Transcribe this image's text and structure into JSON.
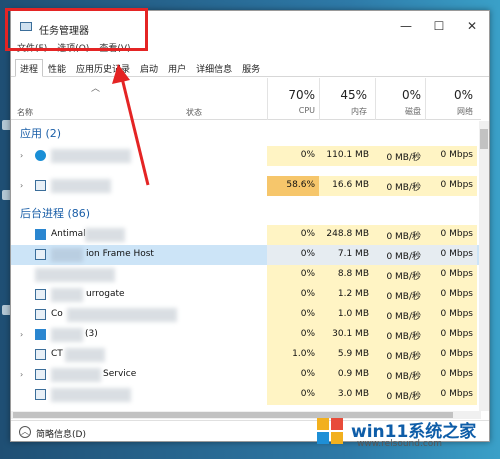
{
  "window": {
    "title": "任务管理器",
    "controls": [
      "—",
      "☐",
      "✕"
    ]
  },
  "menu": [
    "文件(F)",
    "选项(O)",
    "查看(V)"
  ],
  "tabs": [
    "进程",
    "性能",
    "应用历史记录",
    "启动",
    "用户",
    "详细信息",
    "服务"
  ],
  "header": {
    "name": "名称",
    "status": "状态",
    "cpu": {
      "pct": "70%",
      "label": "CPU"
    },
    "mem": {
      "pct": "45%",
      "label": "内存"
    },
    "disk": {
      "pct": "0%",
      "label": "磁盘"
    },
    "net": {
      "pct": "0%",
      "label": "网络"
    }
  },
  "groups": {
    "apps": "应用 (2)",
    "bg": "后台进程 (86)"
  },
  "rows": [
    {
      "name": "",
      "cpu": "0%",
      "mem": "110.1 MB",
      "disk": "0 MB/秒",
      "net": "0 Mbps"
    },
    {
      "name": "",
      "cpu": "58.6%",
      "mem": "16.6 MB",
      "disk": "0 MB/秒",
      "net": "0 Mbps"
    },
    {
      "name": "Antimal",
      "cpu": "0%",
      "mem": "248.8 MB",
      "disk": "0 MB/秒",
      "net": "0 Mbps"
    },
    {
      "name": "ion Frame Host",
      "cpu": "0%",
      "mem": "7.1 MB",
      "disk": "0 MB/秒",
      "net": "0 Mbps"
    },
    {
      "name": "",
      "cpu": "0%",
      "mem": "8.8 MB",
      "disk": "0 MB/秒",
      "net": "0 Mbps"
    },
    {
      "name": "urrogate",
      "cpu": "0%",
      "mem": "1.2 MB",
      "disk": "0 MB/秒",
      "net": "0 Mbps"
    },
    {
      "name": "Co",
      "cpu": "0%",
      "mem": "1.0 MB",
      "disk": "0 MB/秒",
      "net": "0 Mbps"
    },
    {
      "name": "(3)",
      "cpu": "0%",
      "mem": "30.1 MB",
      "disk": "0 MB/秒",
      "net": "0 Mbps"
    },
    {
      "name": "CT",
      "cpu": "1.0%",
      "mem": "5.9 MB",
      "disk": "0 MB/秒",
      "net": "0 Mbps"
    },
    {
      "name": "Service",
      "cpu": "0%",
      "mem": "0.9 MB",
      "disk": "0 MB/秒",
      "net": "0 Mbps"
    },
    {
      "name": "",
      "cpu": "0%",
      "mem": "3.0 MB",
      "disk": "0 MB/秒",
      "net": "0 Mbps"
    }
  ],
  "footer": {
    "fewer": "简略信息(D)"
  },
  "watermark": {
    "text": "win11系统之家",
    "url": "www.relsound.com"
  },
  "colors": {
    "accent": "#1b5fa8",
    "highlight": "#fff4c4",
    "hot": "#f6c66b",
    "annotation": "#e42424"
  }
}
